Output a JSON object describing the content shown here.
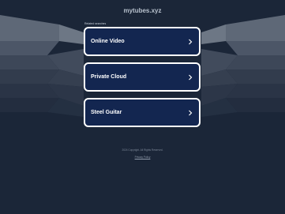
{
  "header": {
    "domain": "mytubes.xyz"
  },
  "section": {
    "label": "Related searches"
  },
  "results": [
    {
      "label": "Online Video"
    },
    {
      "label": "Private Cloud"
    },
    {
      "label": "Steel Guitar"
    }
  ],
  "icons": {
    "result_arrow": "chevron-right-icon"
  },
  "footer": {
    "copyright": "2024 Copyright. All Rights Reserved.",
    "privacy_label": "Privacy Policy"
  },
  "colors": {
    "background": "#1b2638",
    "card": "#132650",
    "card_border": "#ffffff"
  }
}
